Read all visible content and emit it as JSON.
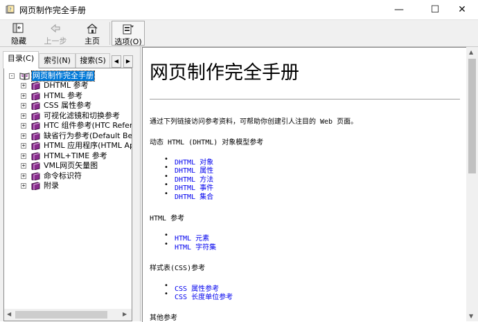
{
  "window": {
    "title": "网页制作完全手册"
  },
  "toolbar": {
    "hide_label": "隐藏",
    "back_label": "上一步",
    "home_label": "主页",
    "options_label": "选项(O)"
  },
  "tabs": [
    {
      "label": "目录(C)"
    },
    {
      "label": "索引(N)"
    },
    {
      "label": "搜索(S)"
    }
  ],
  "tree": {
    "root": "网页制作完全手册",
    "items": [
      {
        "label": "DHTML 参考"
      },
      {
        "label": "HTML 参考"
      },
      {
        "label": "CSS 属性参考"
      },
      {
        "label": "可视化滤镜和切换参考"
      },
      {
        "label": "HTC 组件参考(HTC Refera"
      },
      {
        "label": "缺省行为参考(Default Be"
      },
      {
        "label": "HTML 应用程序(HTML Appl"
      },
      {
        "label": "HTML+TIME 参考"
      },
      {
        "label": "VML网页矢量图"
      },
      {
        "label": "命令标识符"
      },
      {
        "label": "附录"
      }
    ]
  },
  "content": {
    "title": "网页制作完全手册",
    "intro": "通过下列链接访问参考资料，可帮助你创建引人注目的 Web 页面。",
    "sections": [
      {
        "heading": "动态 HTML (DHTML) 对象模型参考",
        "links": [
          "DHTML 对象",
          "DHTML 属性",
          "DHTML 方法",
          "DHTML 事件",
          "DHTML 集合"
        ]
      },
      {
        "heading": "HTML 参考",
        "links": [
          "HTML 元素",
          "HTML 字符集"
        ]
      },
      {
        "heading": "样式表(CSS)参考",
        "links": [
          "CSS 属性参考",
          "CSS 长度单位参考"
        ]
      },
      {
        "heading": "其他参考",
        "links": []
      }
    ]
  },
  "colors": {
    "link": "#0000ee",
    "selection": "#0078d7",
    "book": "#8a2b8e"
  }
}
